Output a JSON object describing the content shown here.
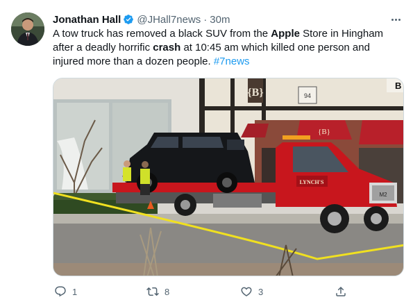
{
  "author": {
    "name": "Jonathan Hall",
    "handle": "@JHall7news",
    "time": "30m",
    "separator": "·"
  },
  "tweet": {
    "text_part1": "A tow truck has removed a black SUV from the ",
    "bold1": "Apple",
    "text_part2": " Store in Hingham after a deadly horrific ",
    "bold2": "crash",
    "text_part3": " at 10:45 am which killed one person and injured more than a dozen people. ",
    "hashtag": "#7news"
  },
  "media": {
    "truck_door_text": "LYNCH'S",
    "truck_grille_text": "M2",
    "store_number": "94",
    "store_sign_letter": "B"
  },
  "actions": {
    "replies": "1",
    "retweets": "8",
    "likes": "3"
  },
  "colors": {
    "accent": "#1d9bf0",
    "secondary_text": "#536471",
    "truck_red": "#c8161d"
  }
}
